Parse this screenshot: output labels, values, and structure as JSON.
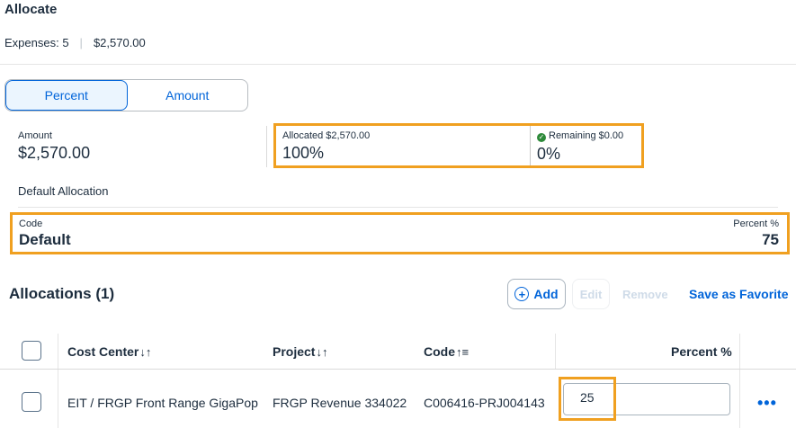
{
  "header": {
    "title": "Allocate",
    "expenses_label": "Expenses: 5",
    "total": "$2,570.00"
  },
  "mode_toggle": {
    "percent_label": "Percent",
    "amount_label": "Amount",
    "selected": "Percent"
  },
  "summary": {
    "amount_label": "Amount",
    "amount_value": "$2,570.00",
    "allocated_label": "Allocated $2,570.00",
    "allocated_value": "100%",
    "remaining_label": "Remaining $0.00",
    "remaining_value": "0%"
  },
  "default_allocation": {
    "section_label": "Default Allocation",
    "code_label": "Code",
    "code_value": "Default",
    "percent_label": "Percent %",
    "percent_value": "75"
  },
  "allocations": {
    "title": "Allocations (1)",
    "actions": {
      "add": "Add",
      "edit": "Edit",
      "remove": "Remove",
      "save_favorite": "Save as Favorite"
    },
    "columns": {
      "cost_center": "Cost Center",
      "project": "Project",
      "code": "Code",
      "percent": "Percent %"
    },
    "rows": [
      {
        "cost_center": "EIT / FRGP Front Range GigaPop",
        "project": "FRGP Revenue 334022",
        "code": "C006416-PRJ004143",
        "percent": "25"
      }
    ]
  },
  "icons": {
    "more": "more-icon",
    "add": "plus-circle-icon",
    "remaining_ok": "check-circle-icon",
    "sort": "sort-icon"
  },
  "colors": {
    "accent": "#0064d9",
    "highlight": "#f0a020",
    "success": "#2e8a3a"
  }
}
